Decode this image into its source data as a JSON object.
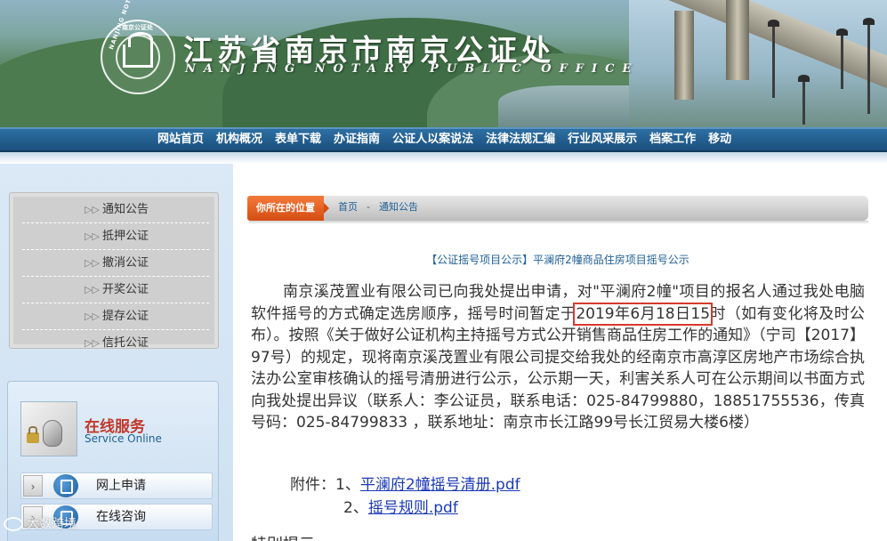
{
  "header": {
    "site_title": "江苏省南京市南京公证处",
    "site_subtitle": "NANJING NOTARY PUBLIC OFFICE",
    "logo_ring_text": "NANJING NOTARY PUBLIC OFFICE",
    "logo_ring_top": "南京公证处"
  },
  "nav": {
    "items": [
      "网站首页",
      "机构概况",
      "表单下载",
      "办证指南",
      "公证人以案说法",
      "法律法规汇编",
      "行业风采展示",
      "档案工作",
      "移动"
    ]
  },
  "sidebar": {
    "menu": [
      "通知公告",
      "抵押公证",
      "撤消公证",
      "开奖公证",
      "提存公证",
      "信托公证"
    ],
    "menu_arrow": "▷▷",
    "service_title": "在线服务",
    "service_subtitle": "Service Online",
    "service_buttons": [
      "网上申请",
      "在线咨询"
    ],
    "chevron": "›"
  },
  "location": {
    "tab": "你所在的位置",
    "crumbs": [
      "首页",
      "通知公告"
    ],
    "separator": "-"
  },
  "article": {
    "title": "【公证摇号项目公示】平澜府2幢商品住房项目摇号公示",
    "body_before": "南京溪茂置业有限公司已向我处提出申请，对\"平澜府2幢\"项目的报名人通过我处电脑软件摇号的方式确定选房顺序，摇号时间暂定于",
    "body_date": "2019年6月18日15",
    "body_after": "时（如有变化将及时公布）。按照《关于做好公证机构主持摇号方式公开销售商品住房工作的通知》（宁司【2017】97号）的规定，现将南京溪茂置业有限公司提交给我处的经南京市高淳区房地产市场综合执法办公室审核确认的摇号清册进行公示，公示期一天，利害关系人可在公示期间以书面方式向我处提出异议（联系人：李公证员，联系电话：025-84799880，18851755536，传真号码：025-84799833 ，联系地址：南京市长江路99号长江贸易大楼6楼）",
    "attachments_label": "附件：",
    "attachments": [
      {
        "index": "1、",
        "name": "平澜府2幢摇号清册.pdf"
      },
      {
        "index": "2、",
        "name": "摇号规则.pdf"
      }
    ],
    "cutoff_text": "特别提示"
  },
  "watermark": "大数跨境",
  "colors": {
    "nav_bg": "#1b4f7e",
    "location_tab": "#d44d12",
    "link_blue": "#1b39b5",
    "title_blue": "#1f5f95",
    "highlight_red": "#d63a2f",
    "service_red": "#c0392b"
  }
}
